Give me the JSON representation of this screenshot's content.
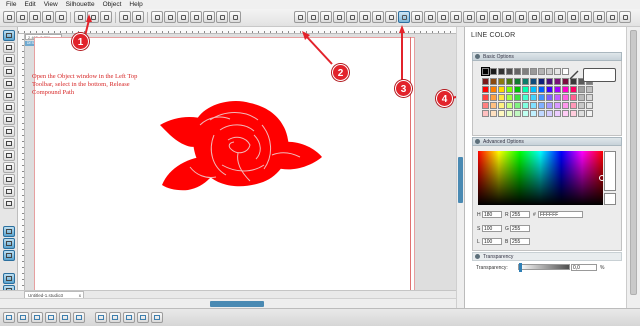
{
  "menu": [
    "File",
    "Edit",
    "View",
    "Silhouette",
    "Object",
    "Help"
  ],
  "workspace": {
    "coord_readout": "2.405, 2.781",
    "view_label": "DESIGN VIEW",
    "document_tab": "Untitled-1.studio3",
    "tab_close": "x"
  },
  "annotation": {
    "text": "Open the Object window in the Left Top Toolbar, select in the bottom, Release Compound Path",
    "color": "#d72828"
  },
  "badges": [
    "1",
    "2",
    "3",
    "4"
  ],
  "panel": {
    "title": "LINE COLOR",
    "basic_options": "Basic Options",
    "advanced_options": "Advanced Options",
    "transparency_header": "Transparency",
    "fields": {
      "H_label": "H",
      "H": "180",
      "R_label": "R",
      "R": "255",
      "hex_label": "#",
      "hex": "FFFFFF",
      "S_label": "S",
      "S": "100",
      "G_label": "G",
      "G": "255",
      "L_label": "L",
      "L": "100",
      "B_label": "B",
      "B": "255"
    },
    "transparency": {
      "label": "Transparency:",
      "value": "0,0",
      "unit": "%"
    },
    "gray_row": [
      "#000000",
      "#1a1a1a",
      "#333333",
      "#4d4d4d",
      "#666666",
      "#808080",
      "#999999",
      "#b3b3b3",
      "#cccccc",
      "#e6e6e6",
      "#ffffff"
    ],
    "color_rows": [
      [
        "#7a1a1a",
        "#8a4a10",
        "#8a7a10",
        "#4a7a10",
        "#107a30",
        "#107a6a",
        "#104a7a",
        "#10207a",
        "#4a107a",
        "#7a107a",
        "#7a1040",
        "#3a3a3a",
        "#5a5a5a",
        "#7a7a7a"
      ],
      [
        "#ff0000",
        "#ff7f00",
        "#ffd800",
        "#7fff00",
        "#00c000",
        "#00ffb0",
        "#00bfff",
        "#0060ff",
        "#4000ff",
        "#a000ff",
        "#ff00c8",
        "#ff0060",
        "#a0a0a0",
        "#c0c0c0"
      ],
      [
        "#ff4040",
        "#ff9f40",
        "#ffe640",
        "#a0ff40",
        "#40e040",
        "#40ffd0",
        "#40d0ff",
        "#4090ff",
        "#7f60ff",
        "#c060ff",
        "#ff60e0",
        "#ff6090",
        "#b8b8b8",
        "#d8d8d8"
      ],
      [
        "#ff8080",
        "#ffc080",
        "#fff080",
        "#c8ff80",
        "#80f080",
        "#80ffe0",
        "#80e0ff",
        "#80b0ff",
        "#a898ff",
        "#d898ff",
        "#ff98ec",
        "#ff98b8",
        "#c8c8c8",
        "#e4e4e4"
      ],
      [
        "#ffc0c0",
        "#ffe0c0",
        "#fff8c0",
        "#e4ffc0",
        "#c0f8c0",
        "#c0fff0",
        "#c0f0ff",
        "#c0d8ff",
        "#d4ccff",
        "#ecccff",
        "#ffccf6",
        "#ffccdc",
        "#dedede",
        "#f2f2f2"
      ]
    ]
  },
  "colors": {
    "accent_blue": "#4a8ab3",
    "shape_red": "#ff0000",
    "badge_red": "#e2232b",
    "cut_line": "#e07070"
  },
  "icons": {
    "top_toolbar": [
      "new-icon",
      "open-icon",
      "save-icon",
      "save-library-icon",
      "print-icon",
      "cut-icon",
      "copy-icon",
      "paste-icon",
      "undo-icon",
      "redo-icon",
      "select-icon",
      "zoom-in-icon",
      "zoom-out-icon",
      "zoom-box-icon",
      "pan-icon",
      "fit-page-icon",
      "page-setup-icon",
      "registration-icon",
      "fill-color-icon",
      "line-color-icon",
      "line-style-icon",
      "text-style-icon",
      "replicate-icon",
      "modify-icon",
      "offset-icon",
      "trace-icon",
      "cut-settings-icon",
      "send-icon",
      "store-icon",
      "library-icon",
      "settings-icon"
    ],
    "left_tools": [
      "pointer-icon",
      "edit-points-icon",
      "line-icon",
      "rectangle-icon",
      "rounded-rectangle-icon",
      "ellipse-icon",
      "polygon-icon",
      "curve-icon",
      "arc-icon",
      "freehand-icon",
      "smooth-freehand-icon",
      "text-icon",
      "eraser-icon",
      "knife-icon"
    ]
  }
}
